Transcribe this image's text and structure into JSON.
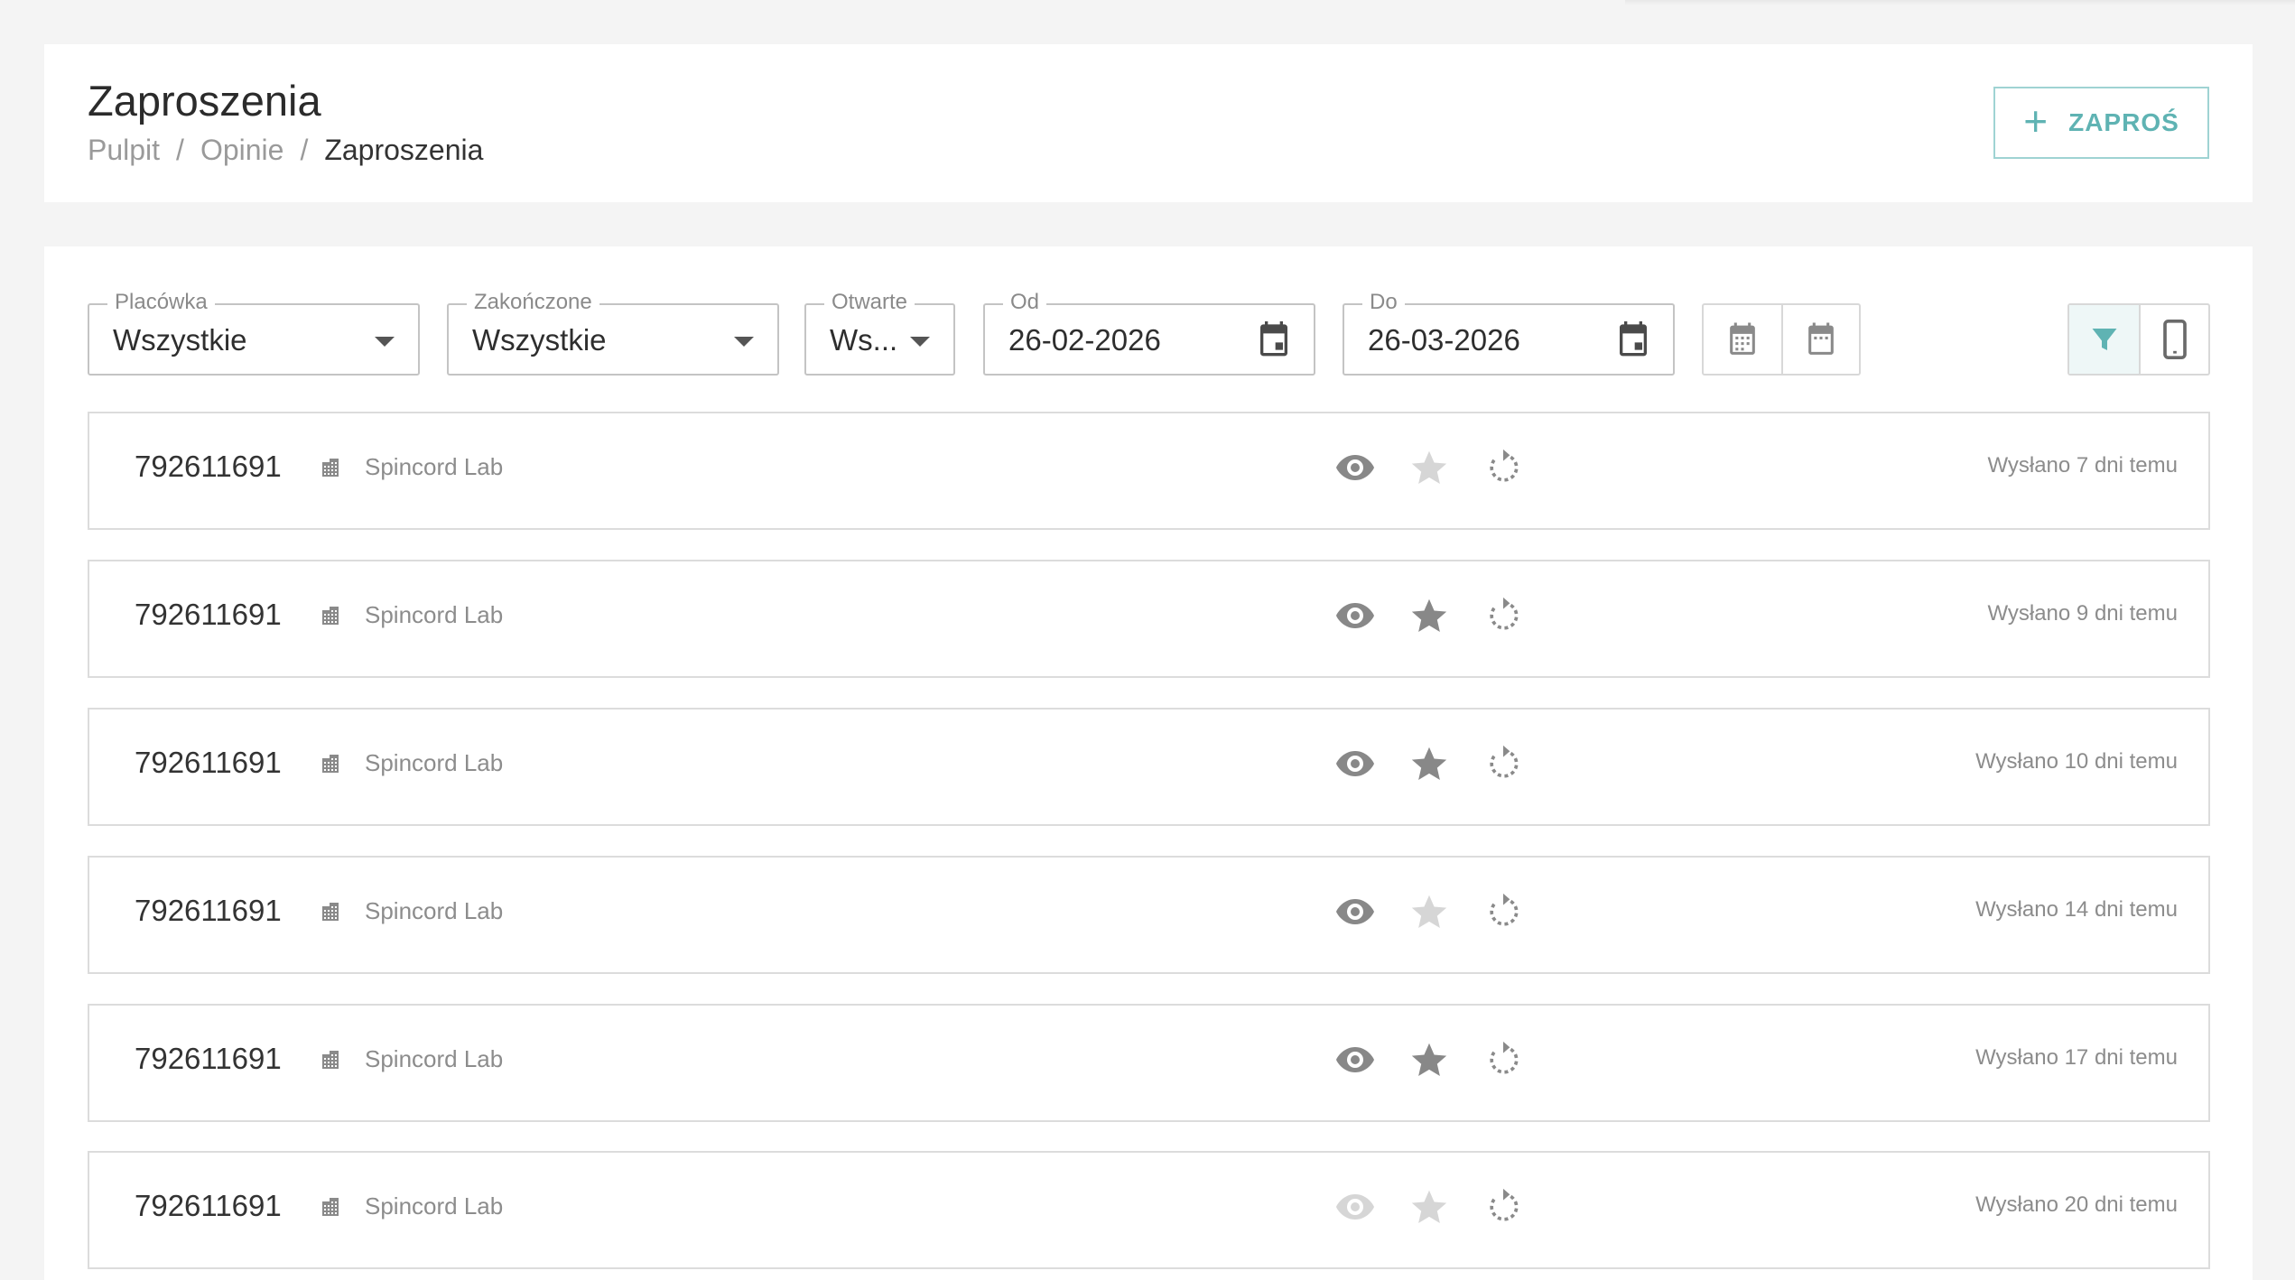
{
  "header": {
    "title": "Zaproszenia",
    "breadcrumb": [
      "Pulpit",
      "/",
      "Opinie",
      "/",
      "Zaproszenia"
    ],
    "invite_label": "ZAPROŚ"
  },
  "filters": {
    "placowka": {
      "label": "Placówka",
      "value": "Wszystkie"
    },
    "zakonczone": {
      "label": "Zakończone",
      "value": "Wszystkie"
    },
    "otwarte": {
      "label": "Otwarte",
      "value": "Ws..."
    },
    "od": {
      "label": "Od",
      "value": "26-02-2026"
    },
    "do": {
      "label": "Do",
      "value": "26-03-2026"
    }
  },
  "colors": {
    "accent": "#5fb3b3",
    "icon_active": "#888888",
    "icon_inactive": "#d6d6d6"
  },
  "rows": [
    {
      "phone": "792611691",
      "clinic": "Spincord Lab",
      "seen": true,
      "rated": false,
      "sent": "Wysłano 7 dni temu"
    },
    {
      "phone": "792611691",
      "clinic": "Spincord Lab",
      "seen": true,
      "rated": true,
      "sent": "Wysłano 9 dni temu"
    },
    {
      "phone": "792611691",
      "clinic": "Spincord Lab",
      "seen": true,
      "rated": true,
      "sent": "Wysłano 10 dni temu"
    },
    {
      "phone": "792611691",
      "clinic": "Spincord Lab",
      "seen": true,
      "rated": false,
      "sent": "Wysłano 14 dni temu"
    },
    {
      "phone": "792611691",
      "clinic": "Spincord Lab",
      "seen": true,
      "rated": true,
      "sent": "Wysłano 17 dni temu"
    },
    {
      "phone": "792611691",
      "clinic": "Spincord Lab",
      "seen": false,
      "rated": false,
      "sent": "Wysłano 20 dni temu"
    }
  ]
}
